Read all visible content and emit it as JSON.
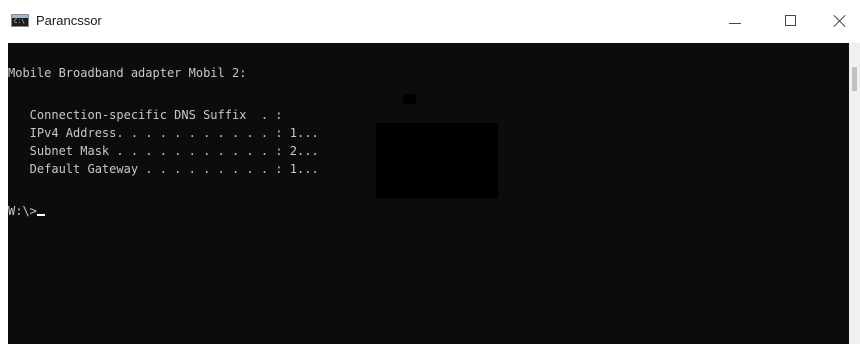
{
  "window": {
    "title": "Parancssor",
    "icon": "cmd-icon",
    "controls": {
      "minimize": "minimize-icon",
      "maximize": "maximize-icon",
      "close": "close-icon"
    }
  },
  "console": {
    "adapter_header": "Mobile Broadband adapter Mobil 2:",
    "dns_suffix_label": "   Connection-specific DNS Suffix  . :",
    "ipv4_label": "   IPv4 Address. . . . . . . . . . . : ",
    "ipv4_value": "1...",
    "subnet_label": "   Subnet Mask . . . . . . . . . . . : ",
    "subnet_value": "2...",
    "gateway_label": "   Default Gateway . . . . . . . . . : ",
    "gateway_value": "1...",
    "prompt": "W:\\>"
  },
  "colors": {
    "console_bg": "#0c0c0c",
    "console_text": "#c8c8c8",
    "titlebar_bg": "#ffffff"
  }
}
